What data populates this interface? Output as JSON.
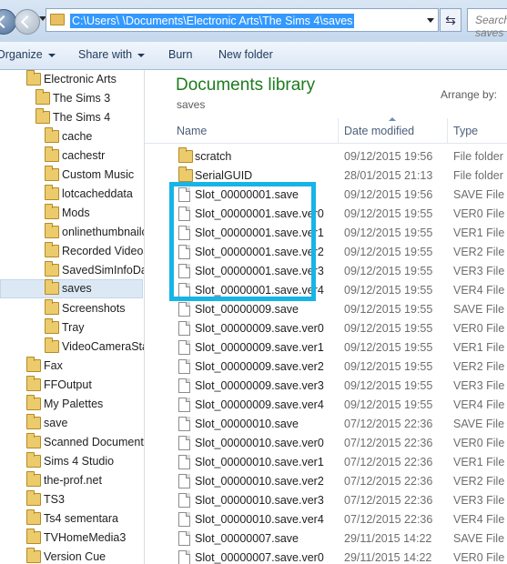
{
  "address": {
    "path": "C:\\Users\\            \\Documents\\Electronic Arts\\The Sims 4\\saves",
    "search_placeholder": "Search saves"
  },
  "toolbar": {
    "organize": "Organize",
    "share_with": "Share with",
    "burn": "Burn",
    "new_folder": "New folder"
  },
  "nav": {
    "items": [
      {
        "label": "Electronic Arts"
      },
      {
        "label": "The Sims 3"
      },
      {
        "label": "The Sims 4"
      },
      {
        "label": "cache"
      },
      {
        "label": "cachestr"
      },
      {
        "label": "Custom Music"
      },
      {
        "label": "lotcacheddata"
      },
      {
        "label": "Mods"
      },
      {
        "label": "onlinethumbnailcache"
      },
      {
        "label": "Recorded Videos"
      },
      {
        "label": "SavedSimInfoData"
      },
      {
        "label": "saves"
      },
      {
        "label": "Screenshots"
      },
      {
        "label": "Tray"
      },
      {
        "label": "VideoCameraStartup"
      },
      {
        "label": "Fax"
      },
      {
        "label": "FFOutput"
      },
      {
        "label": "My Palettes"
      },
      {
        "label": "save"
      },
      {
        "label": "Scanned Documents"
      },
      {
        "label": "Sims 4 Studio"
      },
      {
        "label": "the-prof.net"
      },
      {
        "label": "TS3"
      },
      {
        "label": "Ts4 sementara"
      },
      {
        "label": "TVHomeMedia3"
      },
      {
        "label": "Version Cue"
      }
    ]
  },
  "library": {
    "title": "Documents library",
    "subtitle": "saves",
    "arrange_by": "Arrange by:"
  },
  "columns": {
    "name": "Name",
    "date": "Date modified",
    "type": "Type"
  },
  "files": [
    {
      "name": "scratch",
      "date": "09/12/2015 19:56",
      "type": "File folder",
      "icon": "folder"
    },
    {
      "name": "SerialGUID",
      "date": "28/01/2015 21:13",
      "type": "File folder",
      "icon": "folder"
    },
    {
      "name": "Slot_00000001.save",
      "date": "09/12/2015 19:56",
      "type": "SAVE File",
      "icon": "file"
    },
    {
      "name": "Slot_00000001.save.ver0",
      "date": "09/12/2015 19:55",
      "type": "VER0 File",
      "icon": "file"
    },
    {
      "name": "Slot_00000001.save.ver1",
      "date": "09/12/2015 19:55",
      "type": "VER1 File",
      "icon": "file"
    },
    {
      "name": "Slot_00000001.save.ver2",
      "date": "09/12/2015 19:55",
      "type": "VER2 File",
      "icon": "file"
    },
    {
      "name": "Slot_00000001.save.ver3",
      "date": "09/12/2015 19:55",
      "type": "VER3 File",
      "icon": "file"
    },
    {
      "name": "Slot_00000001.save.ver4",
      "date": "09/12/2015 19:55",
      "type": "VER4 File",
      "icon": "file"
    },
    {
      "name": "Slot_00000009.save",
      "date": "09/12/2015 19:55",
      "type": "SAVE File",
      "icon": "file"
    },
    {
      "name": "Slot_00000009.save.ver0",
      "date": "09/12/2015 19:55",
      "type": "VER0 File",
      "icon": "file"
    },
    {
      "name": "Slot_00000009.save.ver1",
      "date": "09/12/2015 19:55",
      "type": "VER1 File",
      "icon": "file"
    },
    {
      "name": "Slot_00000009.save.ver2",
      "date": "09/12/2015 19:55",
      "type": "VER2 File",
      "icon": "file"
    },
    {
      "name": "Slot_00000009.save.ver3",
      "date": "09/12/2015 19:55",
      "type": "VER3 File",
      "icon": "file"
    },
    {
      "name": "Slot_00000009.save.ver4",
      "date": "09/12/2015 19:55",
      "type": "VER4 File",
      "icon": "file"
    },
    {
      "name": "Slot_00000010.save",
      "date": "07/12/2015 22:36",
      "type": "SAVE File",
      "icon": "file"
    },
    {
      "name": "Slot_00000010.save.ver0",
      "date": "07/12/2015 22:36",
      "type": "VER0 File",
      "icon": "file"
    },
    {
      "name": "Slot_00000010.save.ver1",
      "date": "07/12/2015 22:36",
      "type": "VER1 File",
      "icon": "file"
    },
    {
      "name": "Slot_00000010.save.ver2",
      "date": "07/12/2015 22:36",
      "type": "VER2 File",
      "icon": "file"
    },
    {
      "name": "Slot_00000010.save.ver3",
      "date": "07/12/2015 22:36",
      "type": "VER3 File",
      "icon": "file"
    },
    {
      "name": "Slot_00000010.save.ver4",
      "date": "07/12/2015 22:36",
      "type": "VER4 File",
      "icon": "file"
    },
    {
      "name": "Slot_00000007.save",
      "date": "29/11/2015 14:22",
      "type": "SAVE File",
      "icon": "file"
    },
    {
      "name": "Slot_00000007.save.ver0",
      "date": "29/11/2015 14:22",
      "type": "VER0 File",
      "icon": "file"
    }
  ],
  "colors": {
    "highlight_box": "#17b4e8",
    "library_title": "#1e7b1e",
    "path_selection": "#3399ff"
  }
}
